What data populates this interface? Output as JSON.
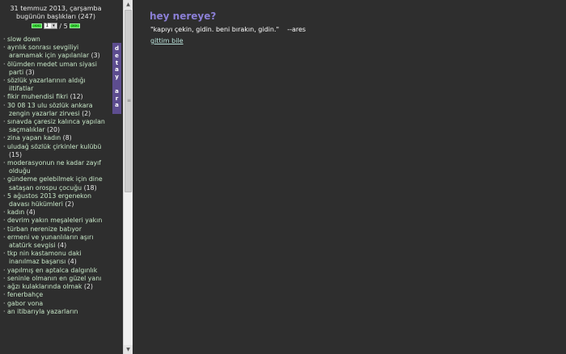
{
  "header": {
    "date_line": "31 temmuz 2013, çarşamba",
    "subtitle": "bugünün başlıkları (247)",
    "pager": {
      "prev_label": "<<",
      "current_page": "1",
      "total_pages": "/ 5",
      "next_label": ">>"
    }
  },
  "sidebar": {
    "tab_label": [
      "d",
      "e",
      "t",
      "a",
      "y",
      "",
      "a",
      "r",
      "a"
    ],
    "topics": [
      {
        "title": "slow down",
        "count": ""
      },
      {
        "title": "ayrılık sonrası sevgiliyi aramamak için yapılanlar",
        "count": "(3)"
      },
      {
        "title": "ölümden medet uman siyasi parti",
        "count": "(3)"
      },
      {
        "title": "sözlük yazarlarının aldığı iltifatlar",
        "count": ""
      },
      {
        "title": "fikir muhendisi fikri",
        "count": "(12)"
      },
      {
        "title": "30 08 13 ulu sözlük ankara zengin yazarlar zirvesi",
        "count": "(2)"
      },
      {
        "title": "sınavda çaresiz kalınca yapılan saçmalıklar",
        "count": "(20)"
      },
      {
        "title": "zina yapan kadın",
        "count": "(8)"
      },
      {
        "title": "uludağ sözlük çirkinler kulübü",
        "count": "(15)"
      },
      {
        "title": "moderasyonun ne kadar zayıf olduğu",
        "count": ""
      },
      {
        "title": "gündeme gelebilmek için dine sataşan orospu çocuğu",
        "count": "(18)"
      },
      {
        "title": "5 ağustos 2013 ergenekon davası hükümleri",
        "count": "(2)"
      },
      {
        "title": "kadın",
        "count": "(4)"
      },
      {
        "title": "devrim yakın meşaleleri yakın",
        "count": ""
      },
      {
        "title": "türban nerenize batıyor",
        "count": ""
      },
      {
        "title": "ermeni ve yunanlıların aşırı atatürk sevgisi",
        "count": "(4)"
      },
      {
        "title": "tkp nin kastamonu daki inanılmaz başarısı",
        "count": "(4)"
      },
      {
        "title": "yapılmış en aptalca dalgınlık",
        "count": ""
      },
      {
        "title": "seninle olmanın en güzel yanı",
        "count": ""
      },
      {
        "title": "ağzı kulaklarında olmak",
        "count": "(2)"
      },
      {
        "title": "fenerbahçe",
        "count": ""
      },
      {
        "title": "gabor vona",
        "count": ""
      },
      {
        "title": "an itibarıyla yazarların",
        "count": ""
      }
    ]
  },
  "scrollbar": {
    "up_arrow": "▲",
    "down_arrow": "▼",
    "grip": "≡"
  },
  "main": {
    "title": "hey nereye?",
    "quote": "\"kapıyı çekin, gidin. beni bırakın, gidin.\"",
    "author": "--ares",
    "link_label": "gittim bile"
  },
  "colors": {
    "background": "#2e2e2e",
    "title": "#8b7fd6",
    "tab": "#5d4d8f",
    "pager_button": "#33cc33"
  }
}
